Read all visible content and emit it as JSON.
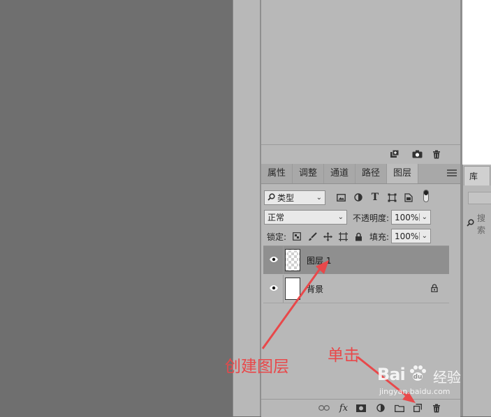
{
  "top_panel": {
    "footer_icons": [
      "new-group-icon",
      "camera-icon",
      "trash-icon"
    ]
  },
  "tabs": [
    "属性",
    "调整",
    "通道",
    "路径",
    "图层"
  ],
  "active_tab": "图层",
  "filter": {
    "kind_label": "类型",
    "search_glyph": "⌕"
  },
  "blend": {
    "mode": "正常",
    "opacity_label": "不透明度:",
    "opacity_value": "100%"
  },
  "lock": {
    "label": "锁定:",
    "fill_label": "填充:",
    "fill_value": "100%"
  },
  "layers": [
    {
      "name": "图层 1",
      "selected": true,
      "thumb": "transparent",
      "visible": true
    },
    {
      "name": "背景",
      "selected": false,
      "thumb": "white",
      "visible": true,
      "locked": true
    }
  ],
  "library": {
    "tab_label": "库",
    "search_placeholder": "搜索"
  },
  "annotations": {
    "create_layer": "创建图层",
    "click": "单击",
    "color": "#e8484a"
  },
  "watermark": {
    "brand": "Bai",
    "brand_suffix": "经验",
    "domain": "jingyan.baidu.com"
  },
  "colors": {
    "panel_bg": "#b8b8b8",
    "selected_row": "#8f8f8f",
    "canvas_bg": "#6f6f6f"
  }
}
